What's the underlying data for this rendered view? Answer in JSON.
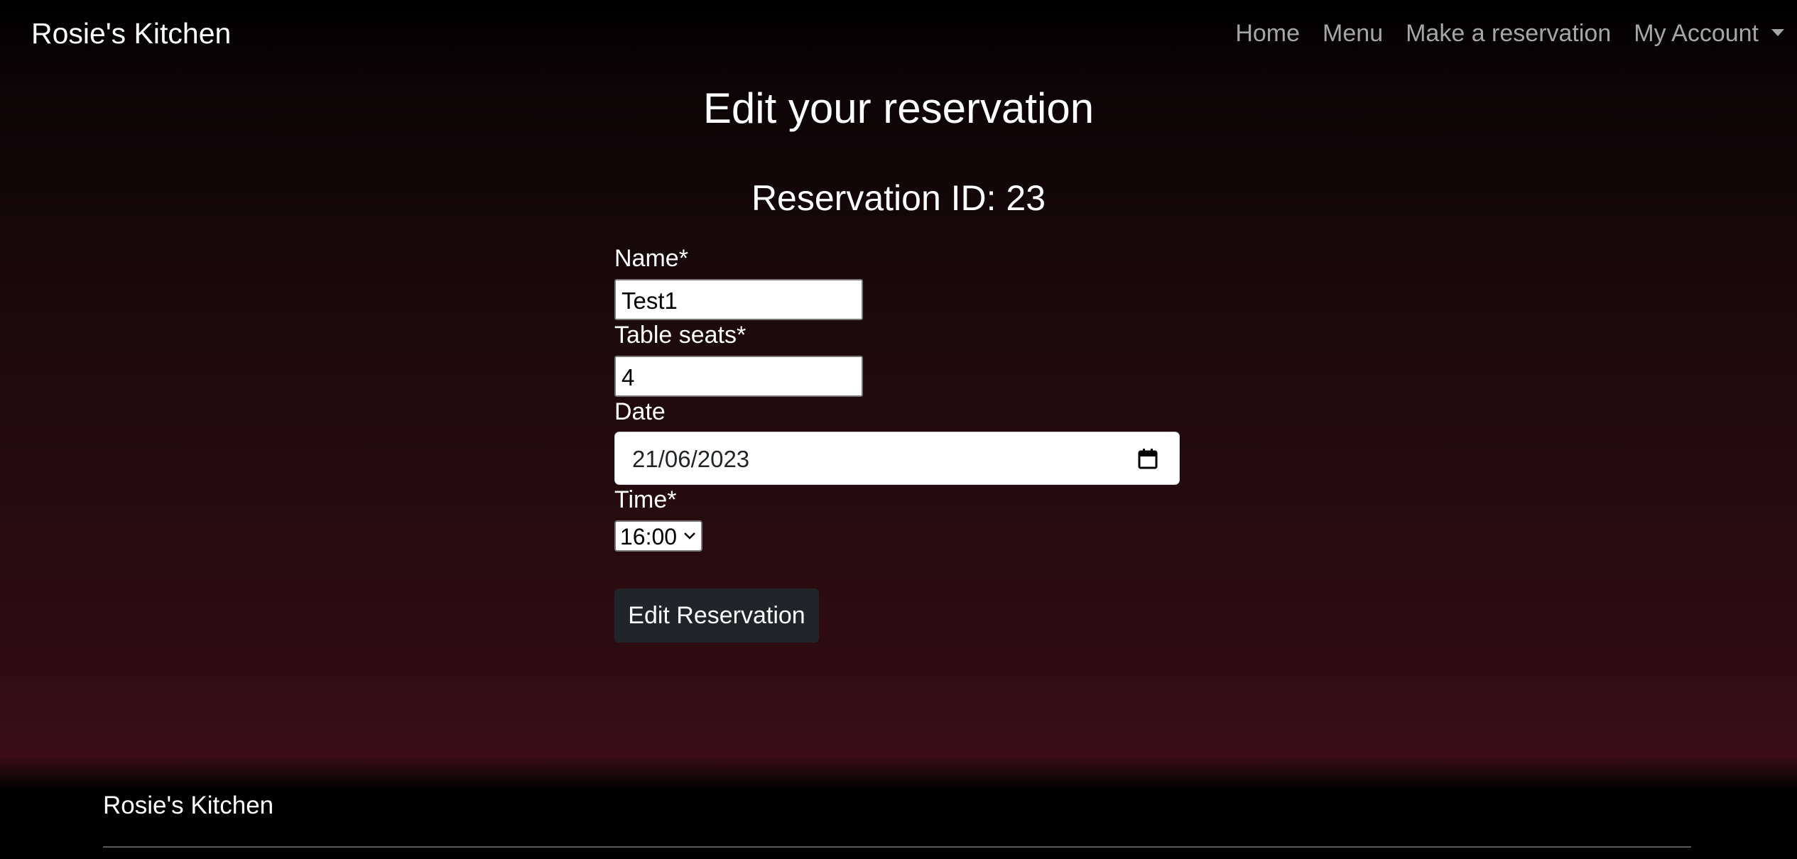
{
  "navbar": {
    "brand": "Rosie's Kitchen",
    "links": [
      "Home",
      "Menu",
      "Make a reservation"
    ],
    "account_label": "My Account"
  },
  "page": {
    "title": "Edit your reservation",
    "reservation_id": "Reservation ID: 23"
  },
  "form": {
    "name_label": "Name*",
    "name_value": "Test1",
    "seats_label": "Table seats*",
    "seats_value": "4",
    "date_label": "Date",
    "date_value": "21/06/2023",
    "time_label": "Time*",
    "time_value": "16:00",
    "submit_label": "Edit Reservation"
  },
  "footer": {
    "brand": "Rosie's Kitchen"
  },
  "icons": {
    "date_picker": "calendar-icon",
    "time_select": "chevron-down-icon",
    "account_dropdown": "caret-down-icon"
  }
}
